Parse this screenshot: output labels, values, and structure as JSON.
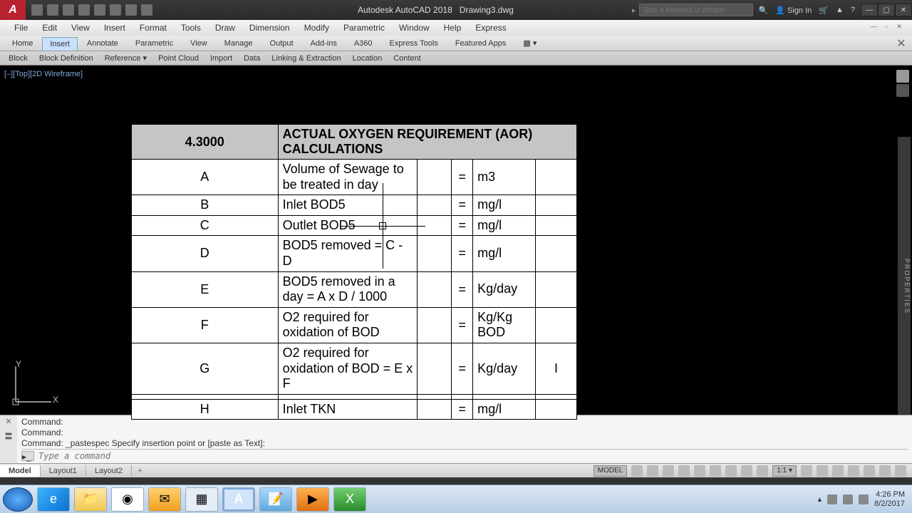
{
  "title": {
    "app": "Autodesk AutoCAD 2018",
    "doc": "Drawing3.dwg"
  },
  "search_placeholder": "Type a keyword or phrase",
  "signin": "Sign In",
  "menus": [
    "File",
    "Edit",
    "View",
    "Insert",
    "Format",
    "Tools",
    "Draw",
    "Dimension",
    "Modify",
    "Parametric",
    "Window",
    "Help",
    "Express"
  ],
  "ribbon_tabs": [
    "Home",
    "Insert",
    "Annotate",
    "Parametric",
    "View",
    "Manage",
    "Output",
    "Add-ins",
    "A360",
    "Express Tools",
    "Featured Apps"
  ],
  "ribbon_active": 1,
  "ribbon_panels": [
    "Block",
    "Block Definition",
    "Reference ▾",
    "Point Cloud",
    "Import",
    "Data",
    "Linking & Extraction",
    "Location",
    "Content"
  ],
  "vp_ctrl": "[–][Top][2D Wireframe]",
  "ucs": {
    "y": "Y",
    "x": "X"
  },
  "props_label": "PROPERTIES",
  "table": {
    "section_no": "4.3000",
    "section_title": "ACTUAL OXYGEN REQUIREMENT (AOR) CALCULATIONS",
    "rows": [
      {
        "id": "A",
        "desc": "Volume of Sewage to be treated in day",
        "eq": "=",
        "unit": "m3",
        "val": ""
      },
      {
        "id": "B",
        "desc": "Inlet BOD5",
        "eq": "=",
        "unit": "mg/l",
        "val": ""
      },
      {
        "id": "C",
        "desc": "Outlet BOD5",
        "eq": "=",
        "unit": "mg/l",
        "val": ""
      },
      {
        "id": "D",
        "desc": "BOD5 removed = C - D",
        "eq": "=",
        "unit": "mg/l",
        "val": ""
      },
      {
        "id": "E",
        "desc": "BOD5 removed in a day = A x D / 1000",
        "eq": "=",
        "unit": "Kg/day",
        "val": ""
      },
      {
        "id": "F",
        "desc": "O2 required for oxidation of BOD",
        "eq": "=",
        "unit": "Kg/Kg BOD",
        "val": ""
      },
      {
        "id": "G",
        "desc": "O2 required for oxidation of BOD = E x F",
        "eq": "=",
        "unit": "Kg/day",
        "val": "I"
      },
      {
        "id": "",
        "desc": "",
        "eq": "",
        "unit": "",
        "val": ""
      },
      {
        "id": "H",
        "desc": "Inlet TKN",
        "eq": "=",
        "unit": "mg/l",
        "val": ""
      }
    ]
  },
  "cmd": {
    "history": [
      "Command:",
      "Command:",
      "Command: _pastespec Specify insertion point or [paste as Text]:"
    ],
    "placeholder": "Type a command"
  },
  "layouts": [
    "Model",
    "Layout1",
    "Layout2"
  ],
  "layout_active": 0,
  "status": {
    "model": "MODEL",
    "scale": "1:1 ▾"
  },
  "tray": {
    "time": "4:26 PM",
    "date": "8/2/2017"
  }
}
